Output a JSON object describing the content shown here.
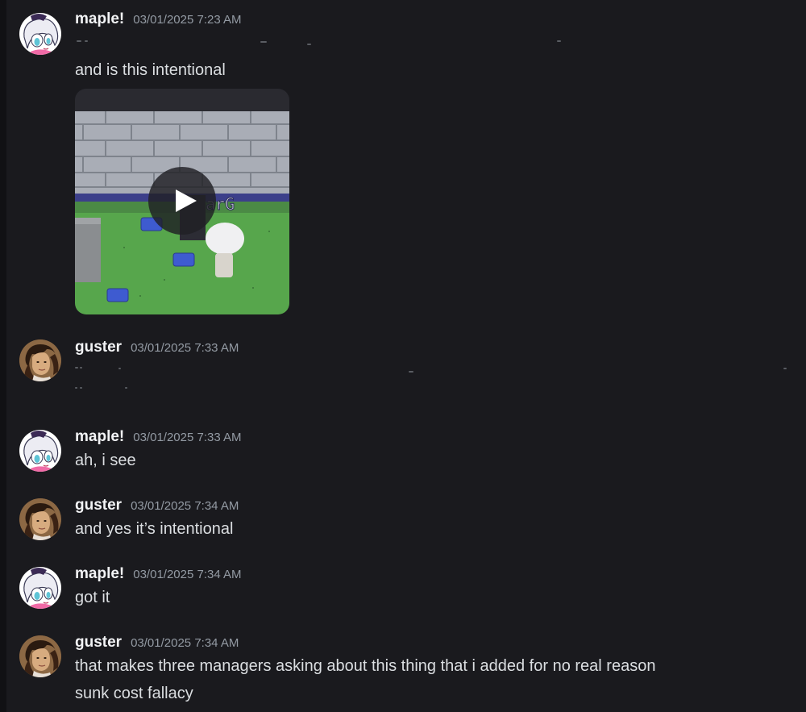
{
  "messages": [
    {
      "author": "maple!",
      "timestamp": "03/01/2025 7:23 AM",
      "lines": [
        "and is this intentional"
      ],
      "attachment": {
        "type": "video",
        "thumbnail_text": "arG",
        "icon": "play-icon"
      }
    },
    {
      "author": "guster",
      "timestamp": "03/01/2025 7:33 AM",
      "lines": []
    },
    {
      "author": "maple!",
      "timestamp": "03/01/2025 7:33 AM",
      "lines": [
        "ah, i see"
      ]
    },
    {
      "author": "guster",
      "timestamp": "03/01/2025 7:34 AM",
      "lines": [
        "and yes it’s intentional"
      ]
    },
    {
      "author": "maple!",
      "timestamp": "03/01/2025 7:34 AM",
      "lines": [
        "got it"
      ]
    },
    {
      "author": "guster",
      "timestamp": "03/01/2025 7:34 AM",
      "lines": [
        "that makes three managers asking about this thing that i added for no real reason",
        "sunk cost fallacy"
      ]
    }
  ],
  "colors": {
    "background": "#1a1a1e",
    "username": "#f2f3f5",
    "timestamp": "#949ba4",
    "text": "#dbdee1"
  }
}
